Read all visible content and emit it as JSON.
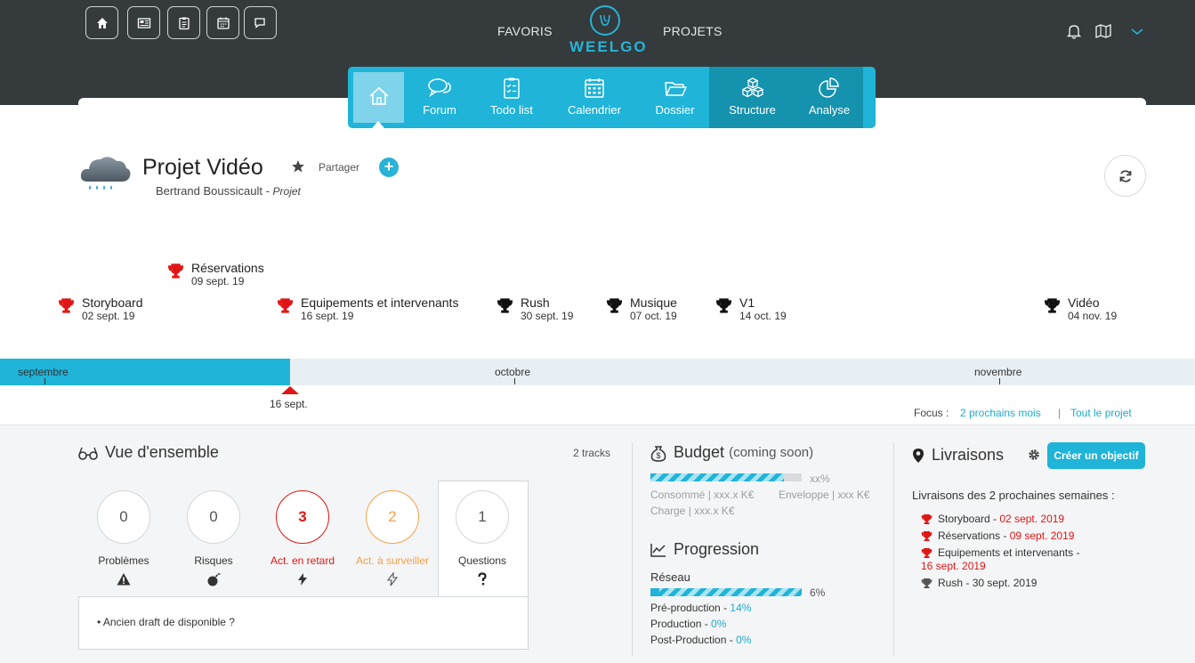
{
  "header": {
    "brand": "WEELGO",
    "nav_left": "FAVORIS",
    "nav_right": "PROJETS",
    "quick_buttons": [
      "home-icon",
      "news-icon",
      "clipboard-icon",
      "calendar-icon",
      "chat-icon"
    ],
    "right_icons": [
      "bell-icon",
      "map-icon",
      "chevron-down-icon"
    ]
  },
  "tabs": [
    {
      "label": "",
      "icon": "home-icon"
    },
    {
      "label": "Forum",
      "icon": "chat-bubbles-icon"
    },
    {
      "label": "Todo list",
      "icon": "checklist-icon"
    },
    {
      "label": "Calendrier",
      "icon": "calendar-icon"
    },
    {
      "label": "Dossier",
      "icon": "folder-icon"
    },
    {
      "label": "Structure",
      "icon": "cubes-icon"
    },
    {
      "label": "Analyse",
      "icon": "pie-chart-icon"
    }
  ],
  "project": {
    "title": "Projet Vidéo",
    "share_label": "Partager",
    "plus_label": "+",
    "owner": "Bertrand Boussicault",
    "owner_sep": " - ",
    "owner_role": "Projet"
  },
  "milestones": [
    {
      "name": "Réservations",
      "date": "09 sept. 19",
      "status": "late"
    },
    {
      "name": "Storyboard",
      "date": "02 sept. 19",
      "status": "late"
    },
    {
      "name": "Equipements et intervenants",
      "date": "16 sept. 19",
      "status": "late"
    },
    {
      "name": "Rush",
      "date": "30 sept. 19",
      "status": "upcoming"
    },
    {
      "name": "Musique",
      "date": "07 oct. 19",
      "status": "upcoming"
    },
    {
      "name": "V1",
      "date": "14 oct. 19",
      "status": "upcoming"
    },
    {
      "name": "Vidéo",
      "date": "04 nov. 19",
      "status": "upcoming"
    }
  ],
  "timeline": {
    "months": [
      "septembre",
      "octobre",
      "novembre"
    ],
    "today": "16 sept.",
    "focus_label": "Focus :",
    "focus_next": "2 prochains mois",
    "focus_sep": "|",
    "focus_all": "Tout le projet"
  },
  "overview": {
    "title": "Vue d'ensemble",
    "tracks": "2 tracks",
    "stats": [
      {
        "label": "Problèmes",
        "value": "0",
        "icon": "warning-icon",
        "color": "#555555"
      },
      {
        "label": "Risques",
        "value": "0",
        "icon": "bomb-icon",
        "color": "#555555"
      },
      {
        "label": "Act. en retard",
        "value": "3",
        "icon": "bolt-icon",
        "color": "#e01616"
      },
      {
        "label": "Act. à surveiller",
        "value": "2",
        "icon": "bolt-outline-icon",
        "color": "#f5a04a"
      },
      {
        "label": "Questions",
        "value": "1",
        "icon": "question-icon",
        "color": "#555555"
      }
    ],
    "question_item": "• Ancien draft de disponible ?"
  },
  "budget": {
    "title": "Budget",
    "note": "(coming soon)",
    "percent": "xx%",
    "consumed": "Consommé | xxx.x K€",
    "envelope": "Enveloppe | xxx K€",
    "charge": "Charge | xxx.x K€"
  },
  "progression": {
    "title": "Progression",
    "network_label": "Réseau",
    "network_percent": "6%",
    "network_value": 0.06,
    "rows": [
      {
        "label": "Pré-production",
        "sep": " - ",
        "value": "14%"
      },
      {
        "label": "Production",
        "sep": " - ",
        "value": "0%"
      },
      {
        "label": "Post-Production",
        "sep": " - ",
        "value": "0%"
      }
    ]
  },
  "deliveries": {
    "title": "Livraisons",
    "create_button": "Créer un objectif",
    "subtitle": "Livraisons des 2 prochaines semaines :",
    "items": [
      {
        "name": "Storyboard",
        "sep": " - ",
        "date": "02 sept. 2019",
        "late": true
      },
      {
        "name": "Réservations",
        "sep": " - ",
        "date": "09 sept. 2019",
        "late": true
      },
      {
        "name": "Equipements et intervenants -",
        "sep": "",
        "date": "16 sept. 2019",
        "late": true
      },
      {
        "name": "Rush",
        "sep": " - ",
        "date": "30 sept. 2019",
        "late": false
      }
    ]
  },
  "colors": {
    "accent": "#1fb4d8",
    "dark": "#353a3d",
    "late": "#e01616",
    "warn": "#f5a04a"
  }
}
